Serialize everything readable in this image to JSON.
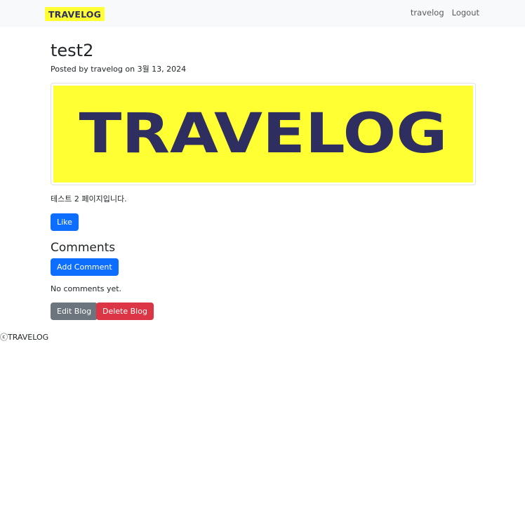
{
  "navbar": {
    "brand": "TRAVELOG",
    "links": [
      "travelog",
      "Logout"
    ]
  },
  "post": {
    "title": "test2",
    "meta": "Posted by travelog on 3월 13, 2024",
    "image_text": "TRAVELOG",
    "body": "테스트 2 페이지입니다.",
    "like_label": "Like"
  },
  "comments": {
    "heading": "Comments",
    "add_label": "Add Comment",
    "empty_text": "No comments yet."
  },
  "actions": {
    "edit_label": "Edit Blog",
    "delete_label": "Delete Blog"
  },
  "footer": {
    "text": "ⓒTRAVELOG"
  },
  "colors": {
    "brand_yellow": "#ffff33",
    "brand_navy": "#2e2e60",
    "primary": "#0d6efd",
    "secondary": "#6c757d",
    "danger": "#dc3545"
  }
}
